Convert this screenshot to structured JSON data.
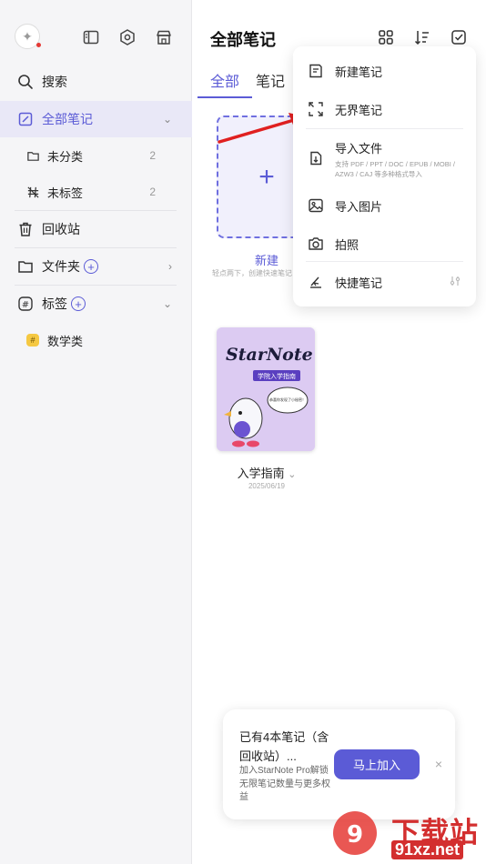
{
  "sidebar": {
    "search_label": "搜索",
    "items": [
      {
        "label": "全部笔记"
      },
      {
        "label": "未分类",
        "count": "2"
      },
      {
        "label": "未标签",
        "count": "2"
      },
      {
        "label": "回收站"
      },
      {
        "label": "文件夹"
      },
      {
        "label": "标签"
      },
      {
        "label": "数学类"
      }
    ]
  },
  "main": {
    "title": "全部笔记",
    "tabs": [
      {
        "label": "全部"
      },
      {
        "label": "笔记"
      }
    ],
    "new_card": {
      "plus": "+",
      "label": "新建",
      "hint": "轻点两下，创建快速笔记"
    },
    "notebook": {
      "cover_title": "StarNote",
      "cover_sub": "学院入学指南",
      "bubble": "恭喜你发现了小秘密！",
      "label": "入学指南",
      "date": "2025/06/19"
    }
  },
  "menu": {
    "items": [
      {
        "label": "新建笔记"
      },
      {
        "label": "无界笔记"
      },
      {
        "label": "导入文件",
        "sub": "支持 PDF / PPT / DOC / EPUB / MOBI / AZW3 / CAJ 等多种格式导入"
      },
      {
        "label": "导入图片"
      },
      {
        "label": "拍照"
      },
      {
        "label": "快捷笔记"
      }
    ]
  },
  "promo": {
    "title": "已有4本笔记（含回收站）...",
    "body": "加入StarNote Pro解锁无限笔记数量与更多权益",
    "button": "马上加入",
    "close": "×"
  },
  "watermark": {
    "text1": "下载站",
    "text2": "91xz.net"
  },
  "colors": {
    "accent": "#5b5bd6",
    "arrow": "#e02020",
    "sidebar_bg": "#f5f5f7"
  }
}
